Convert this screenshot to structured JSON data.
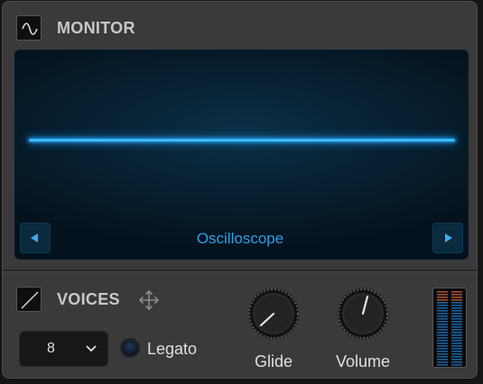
{
  "monitor": {
    "title": "MONITOR",
    "icon": "sine-wave-icon",
    "display": {
      "mode_label": "Oscilloscope",
      "prev_icon": "triangle-left-icon",
      "next_icon": "triangle-right-icon",
      "trace_color": "#3fb9ff",
      "background_color": "#082234"
    }
  },
  "voices": {
    "title": "VOICES",
    "icon": "diagonal-line-icon",
    "move_icon": "move-arrows-icon",
    "count_value": "8",
    "count_chevron": "chevron-down-icon",
    "legato_label": "Legato"
  },
  "knobs": {
    "glide_label": "Glide",
    "volume_label": "Volume"
  },
  "meter": {
    "peak_color": "#c0583a",
    "level_color": "#1f7fd0"
  },
  "colors": {
    "panel": "#3a3a3a",
    "accent": "#2f9ee6"
  }
}
